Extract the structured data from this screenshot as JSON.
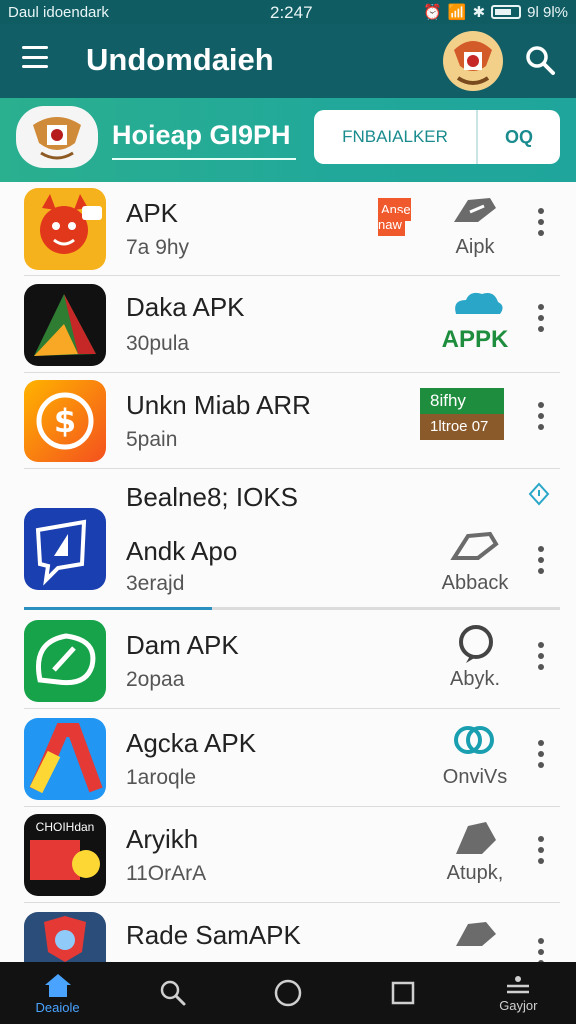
{
  "status_bar": {
    "left_text": "Daul idoendark",
    "time": "2:247",
    "battery": "9l 9l%"
  },
  "app_bar": {
    "title": "Undomdaieh"
  },
  "banner": {
    "title": "Hoieap GI9PH",
    "search_placeholder": "FNBAIALKER",
    "search_button": "OQ"
  },
  "items": [
    {
      "name": "APK",
      "sub": "7a 9hy",
      "action_label": "Aipk",
      "badge_text": "Anse naw"
    },
    {
      "name": "Daka APK",
      "sub": "30pula",
      "action_label": "APPK"
    },
    {
      "name": "Unkn Miab ARR",
      "sub": "5pain",
      "badge_top": "8ifhy",
      "badge_bottom": "1ltroe 07"
    },
    {
      "name": "Bealne8; IOKS",
      "name2": "Andk Apo",
      "sub": "3erajd",
      "action_label": "Abback"
    },
    {
      "name": "Dam APK",
      "sub": "2opaa",
      "action_label": "Abyk."
    },
    {
      "name": "Agcka APK",
      "sub": "1aroqle",
      "action_label": "OnviVs"
    },
    {
      "name": "Aryikh",
      "sub": "11OrArA",
      "action_label": "Atupk,",
      "icon_text": "CHOIHdan"
    },
    {
      "name": "Rade SamAPK",
      "sub": "",
      "action_label": ""
    }
  ],
  "bottom_nav": [
    {
      "label": "Deaiole",
      "icon": "home-icon"
    },
    {
      "label": "",
      "icon": "search-icon"
    },
    {
      "label": "",
      "icon": "circle-icon"
    },
    {
      "label": "",
      "icon": "square-icon"
    },
    {
      "label": "Gayjor",
      "icon": "profile-icon"
    }
  ],
  "colors": {
    "app_bar": "#125e66",
    "banner": "#22aa96",
    "accent": "#1a8c8e",
    "nav_active": "#4aa3ff"
  }
}
